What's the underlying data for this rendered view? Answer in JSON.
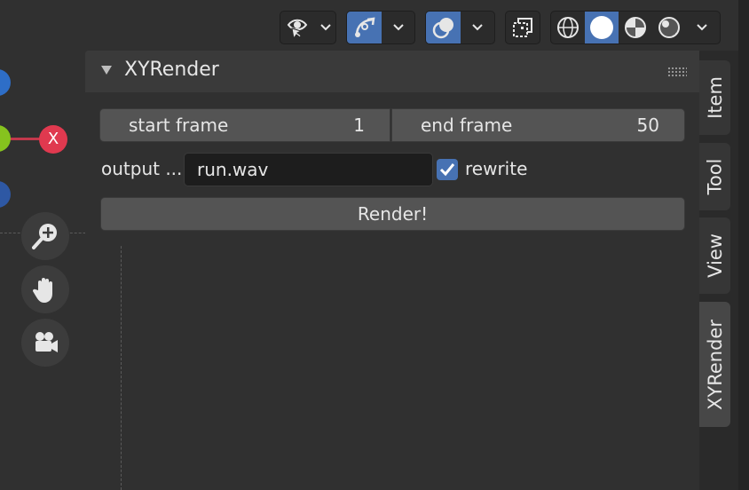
{
  "panel": {
    "title": "XYRender",
    "start_frame": {
      "label": "start frame",
      "value": "1"
    },
    "end_frame": {
      "label": "end frame",
      "value": "50"
    },
    "output_label": "output ...",
    "output_value": "run.wav",
    "rewrite_label": "rewrite",
    "rewrite_checked": true,
    "render_label": "Render!"
  },
  "gizmo": {
    "x_label": "X"
  },
  "tabs": [
    "Item",
    "Tool",
    "View",
    "XYRender"
  ],
  "active_tab": "XYRender",
  "colors": {
    "accent": "#4772b3",
    "x_axis": "#e0394f",
    "y_axis": "#86c31e",
    "z_axis": "#2e6ec7"
  },
  "toolbar_icons": [
    "visibility-icon",
    "gizmo-icon",
    "overlay-icon",
    "xray-icon",
    "wireframe-icon",
    "solid-icon",
    "material-preview-icon",
    "rendered-icon"
  ],
  "nav_icons": [
    "zoom-icon",
    "pan-hand-icon",
    "camera-icon"
  ]
}
